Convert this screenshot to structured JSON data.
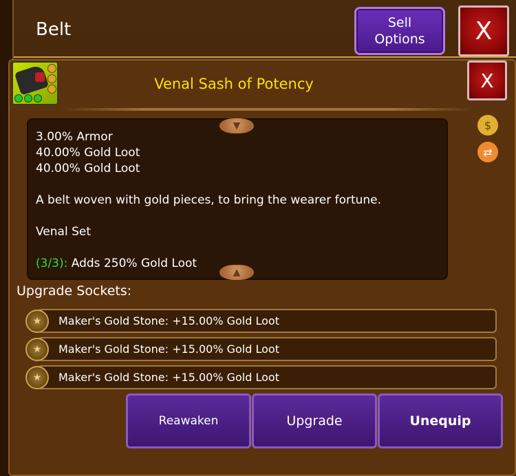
{
  "header": {
    "title": "Belt",
    "sell_options": "Sell\nOptions",
    "close": "X"
  },
  "item": {
    "name": "Venal Sash of Potency",
    "close": "X",
    "stats": [
      "3.00% Armor",
      "40.00% Gold Loot",
      "40.00% Gold Loot"
    ],
    "description": "A belt woven with gold pieces, to bring the wearer fortune.",
    "set_name": "Venal Set",
    "set_count": "(3/3):",
    "set_bonus": "Adds 250% Gold Loot"
  },
  "sockets": {
    "title": "Upgrade Sockets:",
    "items": [
      "Maker's Gold Stone: +15.00% Gold Loot",
      "Maker's Gold Stone: +15.00% Gold Loot",
      "Maker's Gold Stone: +15.00% Gold Loot"
    ]
  },
  "actions": {
    "reawaken": "Reawaken",
    "upgrade": "Upgrade",
    "unequip": "Unequip"
  },
  "colors": {
    "item_name": "#ffe000",
    "set_count": "#2ee02e",
    "button": "#4a1a8c",
    "close": "#8c0606"
  },
  "icons": [
    "belt-item-icon",
    "money-bag-icon",
    "swap-icon",
    "gold-stone-icon",
    "scroll-down-icon",
    "scroll-up-icon"
  ]
}
